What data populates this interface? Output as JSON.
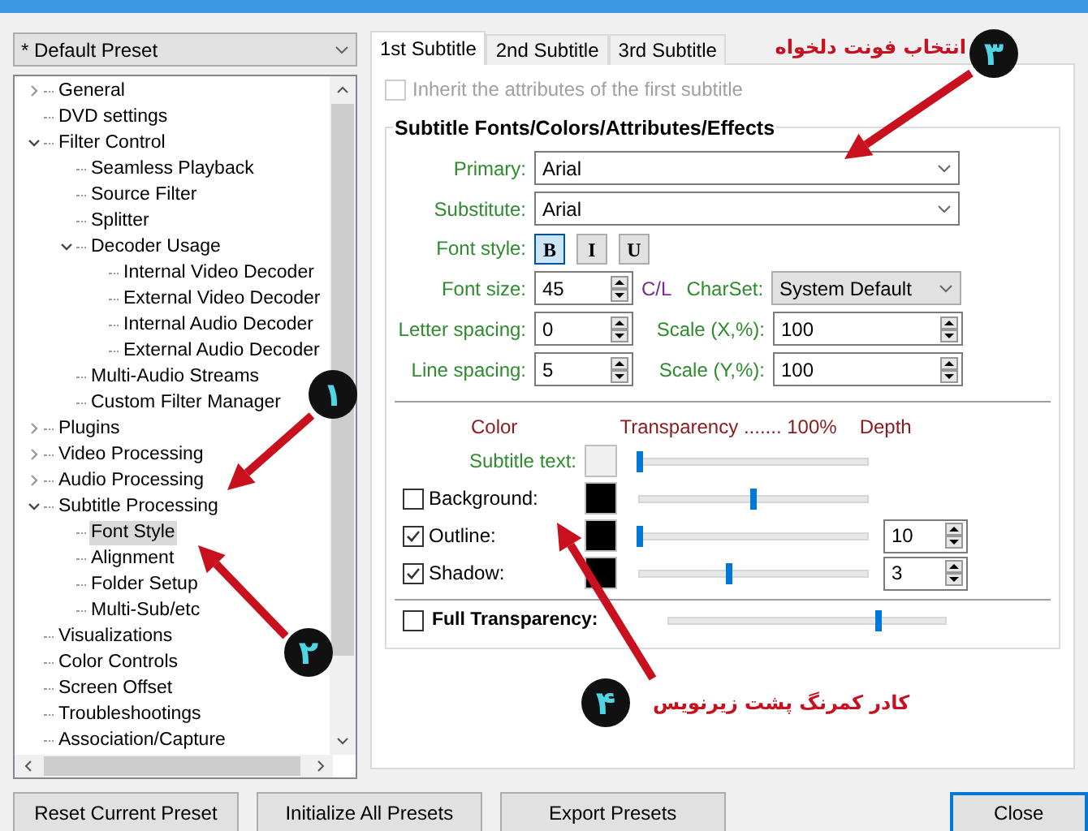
{
  "preset": {
    "value": "* Default Preset"
  },
  "tree": [
    {
      "label": "General",
      "kind": "branch",
      "expanded": false,
      "selected": false
    },
    {
      "label": "DVD settings",
      "kind": "leaf",
      "selected": false
    },
    {
      "label": "Filter Control",
      "kind": "branch",
      "expanded": true,
      "selected": false,
      "children": [
        {
          "label": "Seamless Playback",
          "kind": "leaf",
          "selected": false
        },
        {
          "label": "Source Filter",
          "kind": "leaf",
          "selected": false
        },
        {
          "label": "Splitter",
          "kind": "leaf",
          "selected": false
        },
        {
          "label": "Decoder Usage",
          "kind": "branch",
          "expanded": true,
          "selected": false,
          "children": [
            {
              "label": "Internal Video Decoder",
              "kind": "leaf",
              "selected": false
            },
            {
              "label": "External Video Decoder",
              "kind": "leaf",
              "selected": false
            },
            {
              "label": "Internal Audio Decoder",
              "kind": "leaf",
              "selected": false
            },
            {
              "label": "External Audio Decoder",
              "kind": "leaf",
              "selected": false
            }
          ]
        },
        {
          "label": "Multi-Audio Streams",
          "kind": "leaf",
          "selected": false
        },
        {
          "label": "Custom Filter Manager",
          "kind": "leaf",
          "selected": false
        }
      ]
    },
    {
      "label": "Plugins",
      "kind": "branch",
      "expanded": false,
      "selected": false
    },
    {
      "label": "Video Processing",
      "kind": "branch",
      "expanded": false,
      "selected": false
    },
    {
      "label": "Audio Processing",
      "kind": "branch",
      "expanded": false,
      "selected": false
    },
    {
      "label": "Subtitle Processing",
      "kind": "branch",
      "expanded": true,
      "selected": false,
      "children": [
        {
          "label": "Font Style",
          "kind": "leaf",
          "selected": true
        },
        {
          "label": "Alignment",
          "kind": "leaf",
          "selected": false
        },
        {
          "label": "Folder Setup",
          "kind": "leaf",
          "selected": false
        },
        {
          "label": "Multi-Sub/etc",
          "kind": "leaf",
          "selected": false
        }
      ]
    },
    {
      "label": "Visualizations",
      "kind": "leaf",
      "selected": false
    },
    {
      "label": "Color Controls",
      "kind": "leaf",
      "selected": false
    },
    {
      "label": "Screen Offset",
      "kind": "leaf",
      "selected": false
    },
    {
      "label": "Troubleshootings",
      "kind": "leaf",
      "selected": false
    },
    {
      "label": "Association/Capture",
      "kind": "leaf",
      "selected": false
    }
  ],
  "tabs": [
    {
      "label": "1st Subtitle",
      "selected": true
    },
    {
      "label": "2nd Subtitle",
      "selected": false
    },
    {
      "label": "3rd Subtitle",
      "selected": false
    }
  ],
  "inherit": {
    "label": "Inherit the attributes of the first subtitle",
    "checked": false,
    "disabled": true
  },
  "group_title": "Subtitle Fonts/Colors/Attributes/Effects",
  "primary": {
    "label": "Primary:",
    "value": "Arial"
  },
  "substitute": {
    "label": "Substitute:",
    "value": "Arial"
  },
  "font_style": {
    "label": "Font style:",
    "buttons": [
      {
        "label": "B",
        "selected": true
      },
      {
        "label": "I",
        "selected": false
      },
      {
        "label": "U",
        "selected": false
      }
    ]
  },
  "font_size": {
    "label": "Font size:",
    "value": "45",
    "unit": "C/L"
  },
  "charset": {
    "label": "CharSet:",
    "value": "System Default"
  },
  "letter_spacing": {
    "label": "Letter spacing:",
    "value": "0"
  },
  "scale_x": {
    "label": "Scale (X,%):",
    "value": "100"
  },
  "line_spacing": {
    "label": "Line spacing:",
    "value": "5"
  },
  "scale_y": {
    "label": "Scale (Y,%):",
    "value": "100"
  },
  "headers": [
    "Color",
    "Transparency ....... 100%",
    "Depth"
  ],
  "effects": [
    {
      "label": "Subtitle text:",
      "kind": "plain",
      "color": "#f0f0f0",
      "level": 0
    },
    {
      "label": "Background:",
      "kind": "check",
      "checked": false,
      "color": "#000000",
      "level": 0.5
    },
    {
      "label": "Outline:",
      "kind": "check",
      "checked": true,
      "color": "#000000",
      "level": 0,
      "depth": "10"
    },
    {
      "label": "Shadow:",
      "kind": "check",
      "checked": true,
      "color": "#000000",
      "level": 0.39,
      "depth": "3"
    }
  ],
  "full_transparency": {
    "label": "Full Transparency:",
    "checked": false,
    "level": 0.76
  },
  "buttons": [
    {
      "label": "Reset Current Preset",
      "default": false
    },
    {
      "label": "Initialize All Presets",
      "default": false
    },
    {
      "label": "Export Presets",
      "default": false
    },
    {
      "label": "Close",
      "default": true
    }
  ],
  "annotations": [
    {
      "number": "۱"
    },
    {
      "number": "۲"
    },
    {
      "number": "۳",
      "text": "انتخاب فونت دلخواه"
    },
    {
      "number": "۴",
      "text": "کادر کمرنگ پشت زیرنویس"
    }
  ]
}
